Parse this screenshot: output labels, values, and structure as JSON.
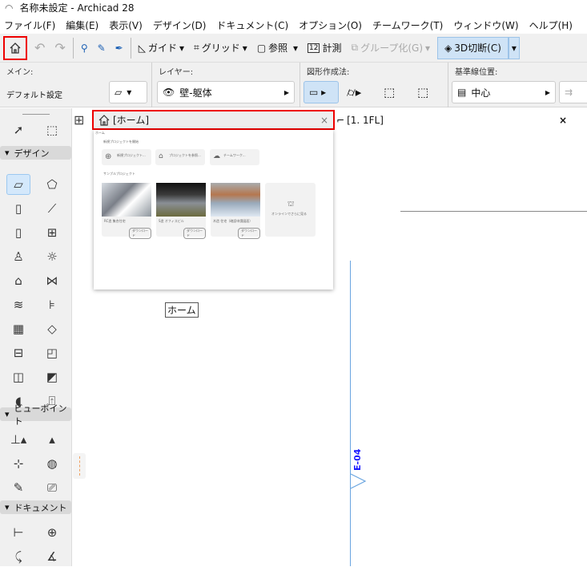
{
  "window": {
    "title": "名称未設定 - Archicad 28"
  },
  "menu": [
    "ファイル(F)",
    "編集(E)",
    "表示(V)",
    "デザイン(D)",
    "ドキュメント(C)",
    "オプション(O)",
    "チームワーク(T)",
    "ウィンドウ(W)",
    "ヘルプ(H)"
  ],
  "toolbar": {
    "guide": "ガイド",
    "grid": "グリッド",
    "reference": "参照",
    "measure": "計測",
    "group": "グループ化(G)",
    "cut3d": "3D切断(C)"
  },
  "infobox": {
    "main_label": "メイン:",
    "default_settings": "デフォルト設定",
    "layer_label": "レイヤー:",
    "layer_value": "壁-躯体",
    "geometry_label": "図形作成法:",
    "refline_label": "基準線位置:",
    "refline_value": "中心"
  },
  "toolbox": {
    "design": "デザイン",
    "viewpoint": "ビューポイント",
    "document": "ドキュメント"
  },
  "tabs": {
    "home": "[ホーム]",
    "floor": "[1. 1FL]"
  },
  "home_preview": {
    "breadcrumb": "ホーム",
    "new_section": "新規プロジェクトを開始",
    "cards": [
      {
        "title": "新規プロジェクト..."
      },
      {
        "title": "プロジェクトを参照..."
      },
      {
        "title": "チームワーク..."
      }
    ],
    "sample_section": "サンプルプロジェクト",
    "samples": [
      {
        "title": "RC造 集合住宅",
        "button": "ダウンロード"
      },
      {
        "title": "S造 オフィスビル",
        "button": "ダウンロード"
      },
      {
        "title": "木造 住宅（確認申請図面）",
        "button": "ダウンロード"
      }
    ],
    "online": "オンラインでさらに見る"
  },
  "canvas": {
    "home_label": "ホーム",
    "marker": "E-04"
  }
}
